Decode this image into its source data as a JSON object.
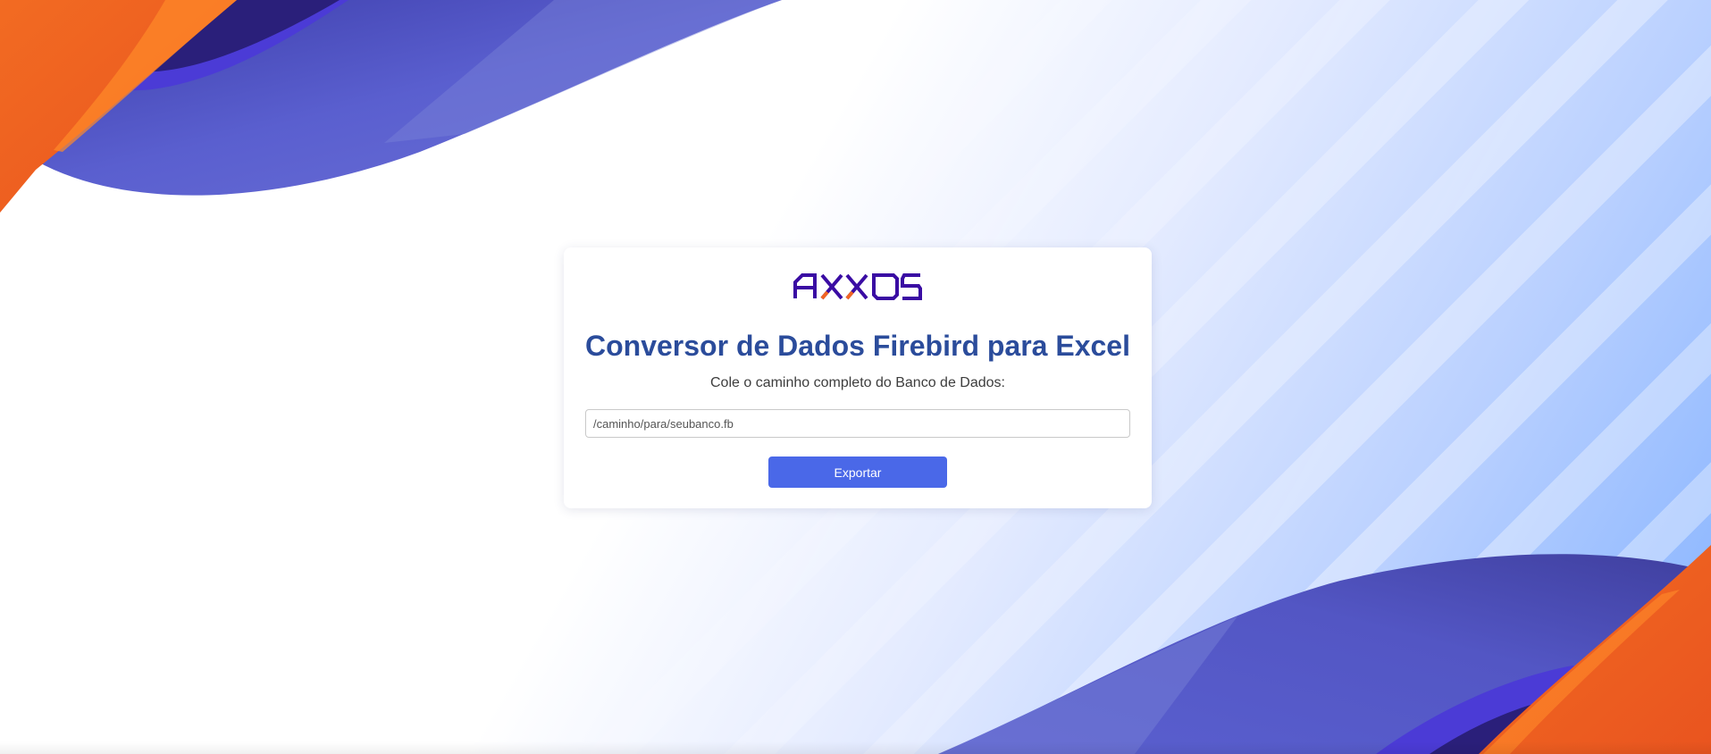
{
  "brand": {
    "logo_text": "AXXOS",
    "primary_color": "#3a0ca3",
    "accent_color": "#f26522"
  },
  "main": {
    "title": "Conversor de Dados Firebird para Excel",
    "instruction": "Cole o caminho completo do Banco de Dados:",
    "path_input": {
      "value": "",
      "placeholder": "/caminho/para/seubanco.fb"
    },
    "export_label": "Exportar",
    "export_button_color": "#4a68e8",
    "title_color": "#2b4c9b"
  }
}
